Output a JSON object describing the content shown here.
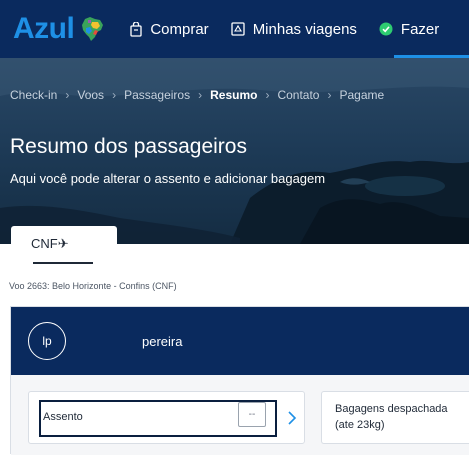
{
  "header": {
    "brand": "Azul",
    "nav": [
      {
        "label": "Comprar",
        "icon": "bag-icon"
      },
      {
        "label": "Minhas viagens",
        "icon": "ticket-icon"
      },
      {
        "label": "Fazer",
        "icon": "check-circle-icon"
      }
    ]
  },
  "hero": {
    "breadcrumb": [
      "Check-in",
      "Voos",
      "Passageiros",
      "Resumo",
      "Contato",
      "Pagame"
    ],
    "active_step": "Resumo",
    "title": "Resumo dos passageiros",
    "subtitle": "Aqui você pode alterar o assento e adicionar bagagem"
  },
  "flight_tab": {
    "label": "CNF"
  },
  "flight_info": "Voo 2663: Belo Horizonte - Confins (CNF)",
  "passenger": {
    "initials": "lp",
    "name": "pereira",
    "seat": {
      "label": "Assento",
      "value": "--"
    },
    "bags": {
      "title": "Bagagens despachada",
      "subtitle": "(ate 23kg)"
    }
  },
  "colors": {
    "navy": "#0a2a5e",
    "accent_blue": "#1e90e6",
    "check_green": "#2ecc71"
  }
}
